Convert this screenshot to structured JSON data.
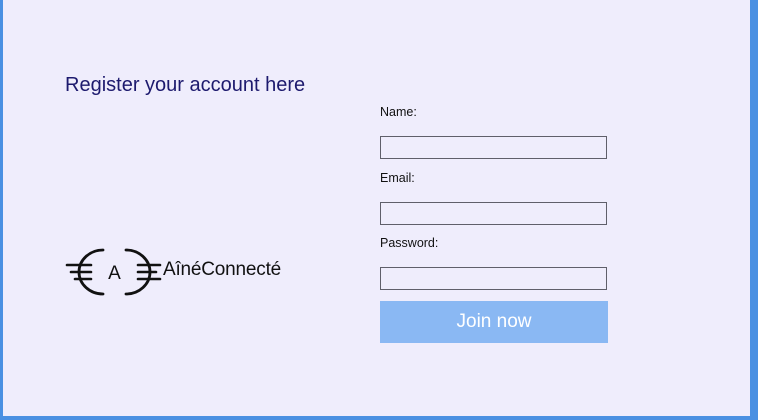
{
  "page": {
    "heading": "Register your account here"
  },
  "brand": {
    "logo_letter": "A",
    "name": "AînéConnecté"
  },
  "form": {
    "name_label": "Name:",
    "name_value": "",
    "email_label": "Email:",
    "email_value": "",
    "password_label": "Password:",
    "password_value": "",
    "submit_label": "Join now"
  },
  "colors": {
    "background": "#efedfc",
    "frame_border": "#4a90e2",
    "heading": "#1d1a6e",
    "button": "#8ab8f3",
    "button_text": "#ffffff"
  }
}
